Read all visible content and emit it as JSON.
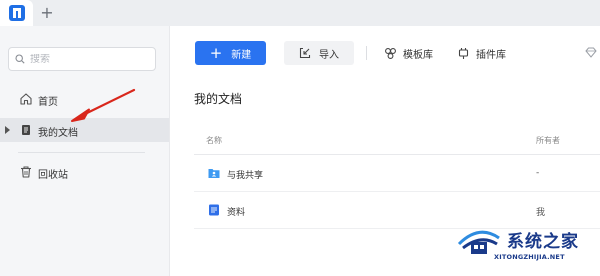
{
  "tabbar": {
    "new_tab_symbol": "+"
  },
  "sidebar": {
    "search_placeholder": "搜索",
    "items": [
      {
        "label": "首页",
        "icon": "home-icon"
      },
      {
        "label": "我的文档",
        "icon": "document-icon",
        "active": true
      },
      {
        "label": "回收站",
        "icon": "trash-icon"
      }
    ]
  },
  "toolbar": {
    "new_label": "新建",
    "import_label": "导入",
    "templates_label": "模板库",
    "plugins_label": "插件库"
  },
  "main": {
    "title": "我的文档",
    "columns": [
      "名称",
      "所有者"
    ],
    "rows": [
      {
        "name": "与我共享",
        "owner": "-",
        "icon": "shared-folder-icon"
      },
      {
        "name": "资料",
        "owner": "我",
        "icon": "doc-file-icon"
      }
    ]
  },
  "watermark": {
    "brand": "系统之家",
    "url": "XITONGZHIJIA.NET"
  },
  "colors": {
    "accent": "#2a73f0",
    "sidebar_bg": "#f5f6f8",
    "annotation": "#d9271c"
  }
}
